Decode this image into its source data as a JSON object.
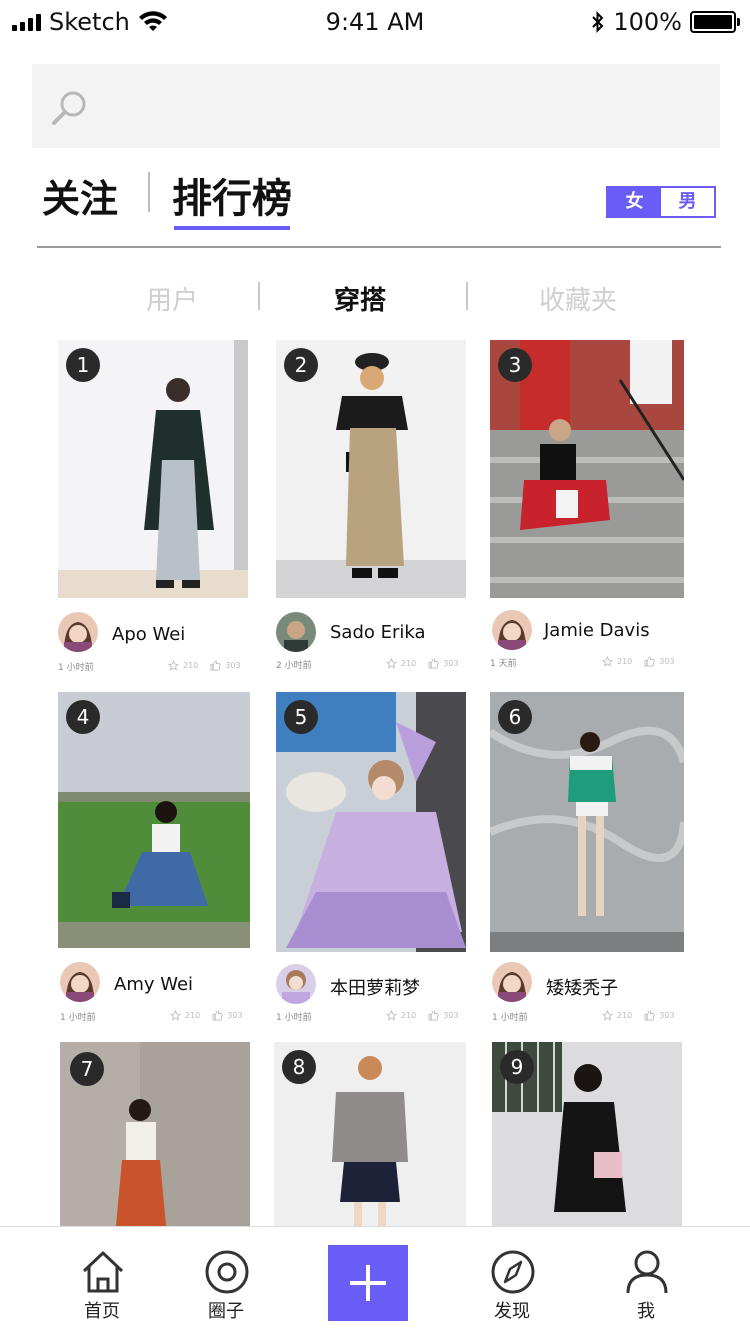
{
  "status_bar": {
    "carrier": "Sketch",
    "time": "9:41 AM",
    "battery": "100%",
    "battery_level": 1.0
  },
  "search": {
    "placeholder": ""
  },
  "main_tabs": {
    "follow": "关注",
    "ranking": "排行榜"
  },
  "gender_toggle": {
    "female": "女",
    "male": "男",
    "selected": "女"
  },
  "sub_tabs": {
    "users": "用户",
    "outfits": "穿搭",
    "favorites": "收藏夹",
    "selected": "穿搭"
  },
  "colors": {
    "accent": "#6a5cf7"
  },
  "cards": [
    {
      "rank": "1",
      "user": "Apo Wei",
      "time": "1 小时前",
      "stars": "210",
      "likes": "303"
    },
    {
      "rank": "2",
      "user": "Sado Erika",
      "time": "2 小时前",
      "stars": "210",
      "likes": "303"
    },
    {
      "rank": "3",
      "user": "Jamie Davis",
      "time": "1 天前",
      "stars": "210",
      "likes": "303"
    },
    {
      "rank": "4",
      "user": "Amy Wei",
      "time": "1 小时前",
      "stars": "210",
      "likes": "303"
    },
    {
      "rank": "5",
      "user": "本田萝莉梦",
      "time": "1 小时前",
      "stars": "210",
      "likes": "303"
    },
    {
      "rank": "6",
      "user": "矮矮秃子",
      "time": "1 小时前",
      "stars": "210",
      "likes": "303"
    },
    {
      "rank": "7"
    },
    {
      "rank": "8"
    },
    {
      "rank": "9"
    }
  ],
  "bottom_nav": {
    "home": "首页",
    "circles": "圈子",
    "discover": "发现",
    "me": "我"
  }
}
